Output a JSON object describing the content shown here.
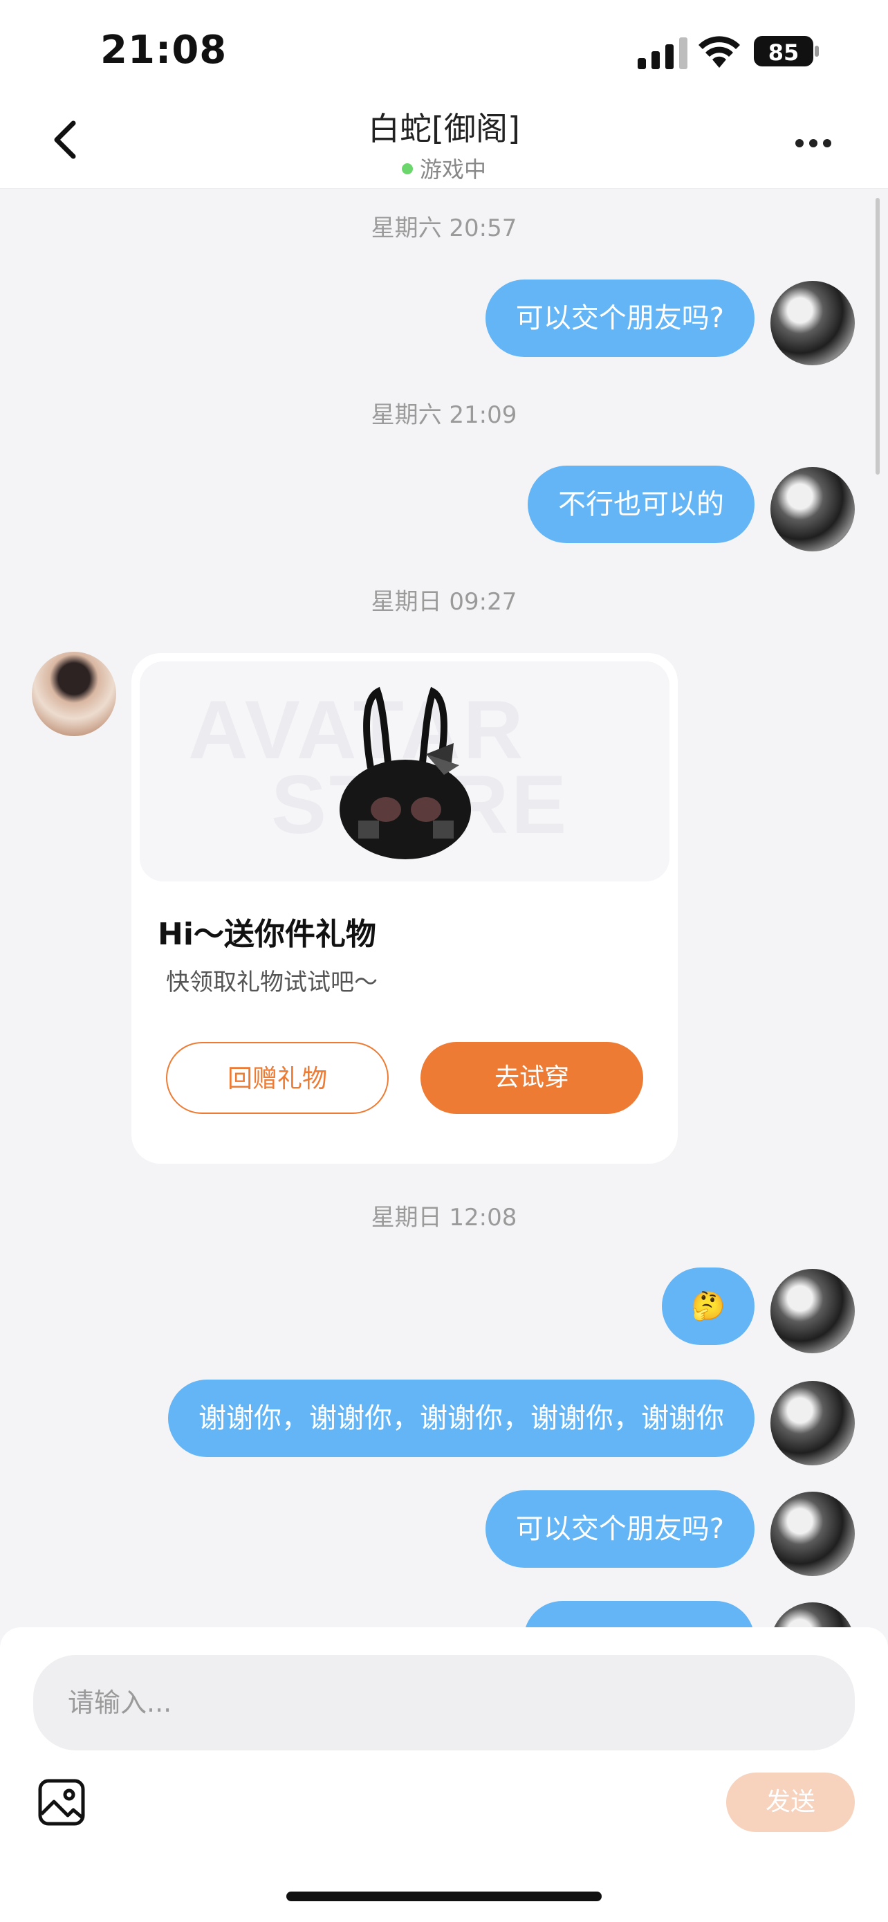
{
  "status_bar": {
    "time": "21:08",
    "battery": "85"
  },
  "header": {
    "title": "白蛇[御阁]",
    "status": "游戏中"
  },
  "messages": [
    {
      "timestamp": "星期六 20:57",
      "text": "可以交个朋友吗?"
    },
    {
      "timestamp": "星期六 21:09",
      "text": "不行也可以的"
    },
    {
      "timestamp": "星期日 09:27"
    },
    {
      "timestamp": "星期日 12:08",
      "text": "🤔"
    },
    {
      "text": "谢谢你，谢谢你，谢谢你，谢谢你，谢谢你"
    },
    {
      "text": "可以交个朋友吗?"
    }
  ],
  "gift_card": {
    "watermark_line1": "AVATAR",
    "watermark_line2": "STORE",
    "title": "Hi～送你件礼物",
    "subtitle": "快领取礼物试试吧～",
    "return_gift_label": "回赠礼物",
    "try_on_label": "去试穿"
  },
  "composer": {
    "placeholder": "请输入...",
    "send_label": "发送"
  },
  "colors": {
    "bubble": "#64b5f6",
    "accent": "#ee7b33",
    "online": "#6bd66b"
  }
}
